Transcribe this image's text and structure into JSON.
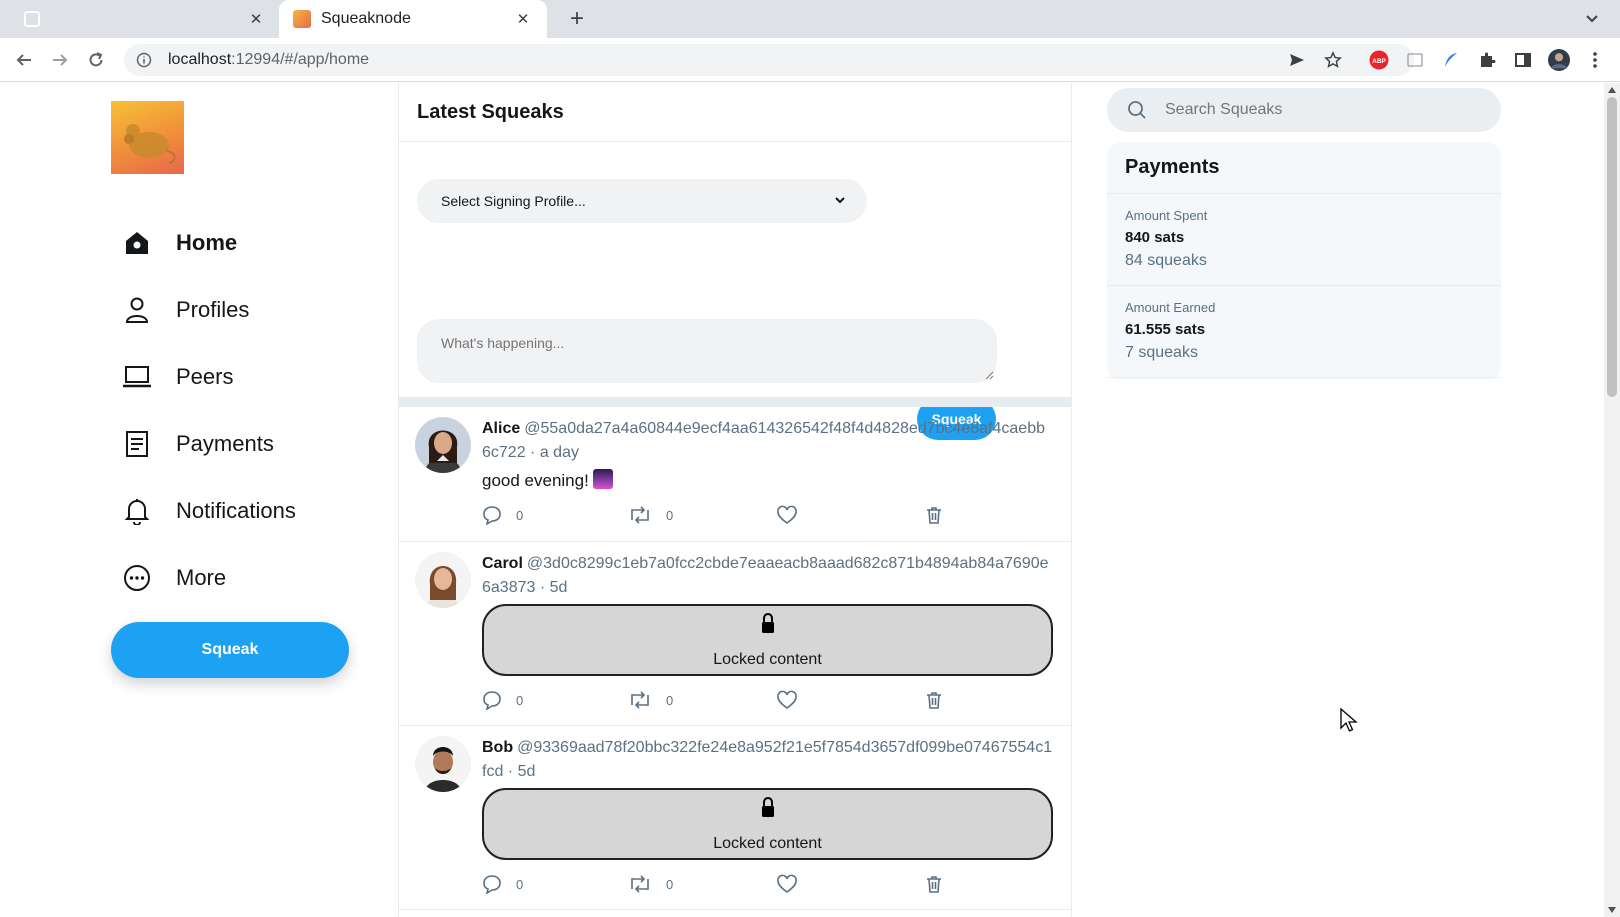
{
  "browser": {
    "tabs": [
      {
        "title": "",
        "active": false
      },
      {
        "title": "Squeaknode",
        "active": true
      }
    ],
    "url_host": "localhost",
    "url_rest": ":12994/#/app/home",
    "abp_label": "ABP"
  },
  "sidebar": {
    "items": [
      {
        "label": "Home",
        "icon": "home-icon",
        "active": true
      },
      {
        "label": "Profiles",
        "icon": "person-icon"
      },
      {
        "label": "Peers",
        "icon": "laptop-icon"
      },
      {
        "label": "Payments",
        "icon": "receipt-icon"
      },
      {
        "label": "Notifications",
        "icon": "bell-icon"
      },
      {
        "label": "More",
        "icon": "more-icon"
      }
    ],
    "squeak_button": "Squeak"
  },
  "main": {
    "title": "Latest Squeaks",
    "compose": {
      "select_placeholder": "Select Signing Profile...",
      "text_placeholder": "What's happening...",
      "button": "Squeak"
    },
    "squeaks": [
      {
        "name": "Alice",
        "handle": "@55a0da27a4a60844e9ecf4aa614326542f48f4d4828ed7bc4e8af4caebb6c722",
        "time": "a day",
        "text": "good evening!",
        "locked": false,
        "replies": "0",
        "resqueaks": "0"
      },
      {
        "name": "Carol",
        "handle": "@3d0c8299c1eb7a0fcc2cbde7eaaeacb8aaad682c871b4894ab84a7690e6a3873",
        "time": "5d",
        "locked": true,
        "locked_text": "Locked content",
        "replies": "0",
        "resqueaks": "0"
      },
      {
        "name": "Bob",
        "handle": "@93369aad78f20bbc322fe24e8a952f21e5f7854d3657df099be07467554c1fcd",
        "time": "5d",
        "locked": true,
        "locked_text": "Locked content",
        "replies": "0",
        "resqueaks": "0"
      }
    ]
  },
  "right": {
    "search_placeholder": "Search Squeaks",
    "payments": {
      "title": "Payments",
      "spent_label": "Amount Spent",
      "spent_value": "840 sats",
      "spent_count": "84 squeaks",
      "earned_label": "Amount Earned",
      "earned_value": "61.555 sats",
      "earned_count": "7 squeaks"
    }
  },
  "colors": {
    "accent": "#1da1f2",
    "chrome": "#dee1e6"
  }
}
